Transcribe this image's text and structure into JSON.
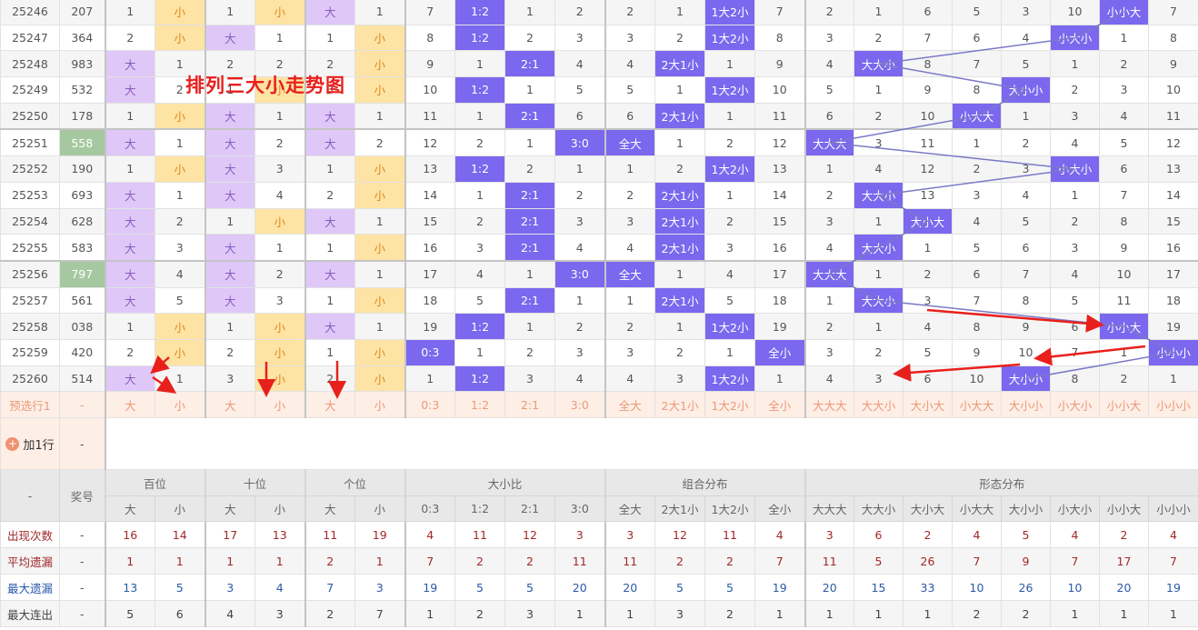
{
  "title_overlay": "排列三大小走势图",
  "colors": {
    "big_bg": "#dfc8f8",
    "small_bg": "#fde3a4",
    "hit_bg": "#7b68ee",
    "highlight_number": "#a6c8a0",
    "annotation_red": "#e8201c",
    "trend_line": "#7b78c8"
  },
  "rows": [
    {
      "issue": "25246",
      "number": "207",
      "cells": [
        "1",
        "小",
        "1",
        "小",
        "大",
        "1",
        "7",
        "1:2",
        "1",
        "2",
        "2",
        "1",
        "1大2小",
        "7",
        "2",
        "1",
        "6",
        "5",
        "3",
        "10",
        "小小大",
        "7"
      ]
    },
    {
      "issue": "25247",
      "number": "364",
      "cells": [
        "2",
        "小",
        "大",
        "1",
        "1",
        "小",
        "8",
        "1:2",
        "2",
        "3",
        "3",
        "2",
        "1大2小",
        "8",
        "3",
        "2",
        "7",
        "6",
        "4",
        "小大小",
        "1",
        "8"
      ]
    },
    {
      "issue": "25248",
      "number": "983",
      "cells": [
        "大",
        "1",
        "2",
        "2",
        "2",
        "小",
        "9",
        "1",
        "2:1",
        "4",
        "4",
        "2大1小",
        "1",
        "9",
        "4",
        "大大小",
        "8",
        "7",
        "5",
        "1",
        "2",
        "9"
      ]
    },
    {
      "issue": "25249",
      "number": "532",
      "cells": [
        "大",
        "2",
        "1",
        "小",
        "3",
        "小",
        "10",
        "1:2",
        "1",
        "5",
        "5",
        "1",
        "1大2小",
        "10",
        "5",
        "1",
        "9",
        "8",
        "大小小",
        "2",
        "3",
        "10"
      ]
    },
    {
      "issue": "25250",
      "number": "178",
      "cells": [
        "1",
        "小",
        "大",
        "1",
        "大",
        "1",
        "11",
        "1",
        "2:1",
        "6",
        "6",
        "2大1小",
        "1",
        "11",
        "6",
        "2",
        "10",
        "小大大",
        "1",
        "3",
        "4",
        "11"
      ]
    },
    {
      "issue": "25251",
      "number": "558",
      "highlight": true,
      "cells": [
        "大",
        "1",
        "大",
        "2",
        "大",
        "2",
        "12",
        "2",
        "1",
        "3:0",
        "全大",
        "1",
        "2",
        "12",
        "大大大",
        "3",
        "11",
        "1",
        "2",
        "4",
        "5",
        "12"
      ]
    },
    {
      "issue": "25252",
      "number": "190",
      "cells": [
        "1",
        "小",
        "大",
        "3",
        "1",
        "小",
        "13",
        "1:2",
        "2",
        "1",
        "1",
        "2",
        "1大2小",
        "13",
        "1",
        "4",
        "12",
        "2",
        "3",
        "小大小",
        "6",
        "13"
      ]
    },
    {
      "issue": "25253",
      "number": "693",
      "cells": [
        "大",
        "1",
        "大",
        "4",
        "2",
        "小",
        "14",
        "1",
        "2:1",
        "2",
        "2",
        "2大1小",
        "1",
        "14",
        "2",
        "大大小",
        "13",
        "3",
        "4",
        "1",
        "7",
        "14"
      ]
    },
    {
      "issue": "25254",
      "number": "628",
      "cells": [
        "大",
        "2",
        "1",
        "小",
        "大",
        "1",
        "15",
        "2",
        "2:1",
        "3",
        "3",
        "2大1小",
        "2",
        "15",
        "3",
        "1",
        "大小大",
        "4",
        "5",
        "2",
        "8",
        "15"
      ]
    },
    {
      "issue": "25255",
      "number": "583",
      "cells": [
        "大",
        "3",
        "大",
        "1",
        "1",
        "小",
        "16",
        "3",
        "2:1",
        "4",
        "4",
        "2大1小",
        "3",
        "16",
        "4",
        "大大小",
        "1",
        "5",
        "6",
        "3",
        "9",
        "16"
      ]
    },
    {
      "issue": "25256",
      "number": "797",
      "highlight": true,
      "cells": [
        "大",
        "4",
        "大",
        "2",
        "大",
        "1",
        "17",
        "4",
        "1",
        "3:0",
        "全大",
        "1",
        "4",
        "17",
        "大大大",
        "1",
        "2",
        "6",
        "7",
        "4",
        "10",
        "17"
      ]
    },
    {
      "issue": "25257",
      "number": "561",
      "cells": [
        "大",
        "5",
        "大",
        "3",
        "1",
        "小",
        "18",
        "5",
        "2:1",
        "1",
        "1",
        "2大1小",
        "5",
        "18",
        "1",
        "大大小",
        "3",
        "7",
        "8",
        "5",
        "11",
        "18"
      ]
    },
    {
      "issue": "25258",
      "number": "038",
      "cells": [
        "1",
        "小",
        "1",
        "小",
        "大",
        "1",
        "19",
        "1:2",
        "1",
        "2",
        "2",
        "1",
        "1大2小",
        "19",
        "2",
        "1",
        "4",
        "8",
        "9",
        "6",
        "小小大",
        "19"
      ]
    },
    {
      "issue": "25259",
      "number": "420",
      "cells": [
        "2",
        "小",
        "2",
        "小",
        "1",
        "小",
        "0:3",
        "1",
        "2",
        "3",
        "3",
        "2",
        "1",
        "全小",
        "3",
        "2",
        "5",
        "9",
        "10",
        "7",
        "1",
        "小小小"
      ]
    },
    {
      "issue": "25260",
      "number": "514",
      "cells": [
        "大",
        "1",
        "3",
        "小",
        "2",
        "小",
        "1",
        "1:2",
        "3",
        "4",
        "4",
        "3",
        "1大2小",
        "1",
        "4",
        "3",
        "6",
        "10",
        "大小小",
        "8",
        "2",
        "1"
      ]
    }
  ],
  "preselect": {
    "label": "预选行1",
    "number": "-",
    "cells": [
      "大",
      "小",
      "大",
      "小",
      "大",
      "小",
      "0:3",
      "1:2",
      "2:1",
      "3:0",
      "全大",
      "2大1小",
      "1大2小",
      "全小",
      "大大大",
      "大大小",
      "大小大",
      "小大大",
      "大小小",
      "小大小",
      "小小大",
      "小小小"
    ]
  },
  "add_row": {
    "label": "加1行",
    "icon": "plus-circle-icon",
    "number": "-"
  },
  "header": {
    "corner": "-",
    "number_label": "奖号",
    "groups": [
      "百位",
      "十位",
      "个位",
      "大小比",
      "组合分布",
      "形态分布"
    ],
    "sub": [
      "大",
      "小",
      "大",
      "小",
      "大",
      "小",
      "0:3",
      "1:2",
      "2:1",
      "3:0",
      "全大",
      "2大1小",
      "1大2小",
      "全小",
      "大大大",
      "大大小",
      "大小大",
      "小大大",
      "大小小",
      "小大小",
      "小小大",
      "小小小"
    ]
  },
  "stats": [
    {
      "label": "出现次数",
      "number": "-",
      "color": "#a0282a",
      "values": [
        "16",
        "14",
        "17",
        "13",
        "11",
        "19",
        "4",
        "11",
        "12",
        "3",
        "3",
        "12",
        "11",
        "4",
        "3",
        "6",
        "2",
        "4",
        "5",
        "4",
        "2",
        "4"
      ]
    },
    {
      "label": "平均遗漏",
      "number": "-",
      "color": "#a0282a",
      "values": [
        "1",
        "1",
        "1",
        "1",
        "2",
        "1",
        "7",
        "2",
        "2",
        "11",
        "11",
        "2",
        "2",
        "7",
        "11",
        "5",
        "26",
        "7",
        "9",
        "7",
        "17",
        "7"
      ]
    },
    {
      "label": "最大遗漏",
      "number": "-",
      "color": "#2a5aa8",
      "values": [
        "13",
        "5",
        "3",
        "4",
        "7",
        "3",
        "19",
        "5",
        "5",
        "20",
        "20",
        "5",
        "5",
        "19",
        "20",
        "15",
        "33",
        "10",
        "26",
        "10",
        "20",
        "19"
      ]
    },
    {
      "label": "最大连出",
      "number": "-",
      "color": "#444444",
      "values": [
        "5",
        "6",
        "4",
        "3",
        "2",
        "7",
        "1",
        "2",
        "3",
        "1",
        "1",
        "3",
        "2",
        "1",
        "1",
        "1",
        "1",
        "2",
        "2",
        "1",
        "1",
        "1"
      ]
    }
  ]
}
